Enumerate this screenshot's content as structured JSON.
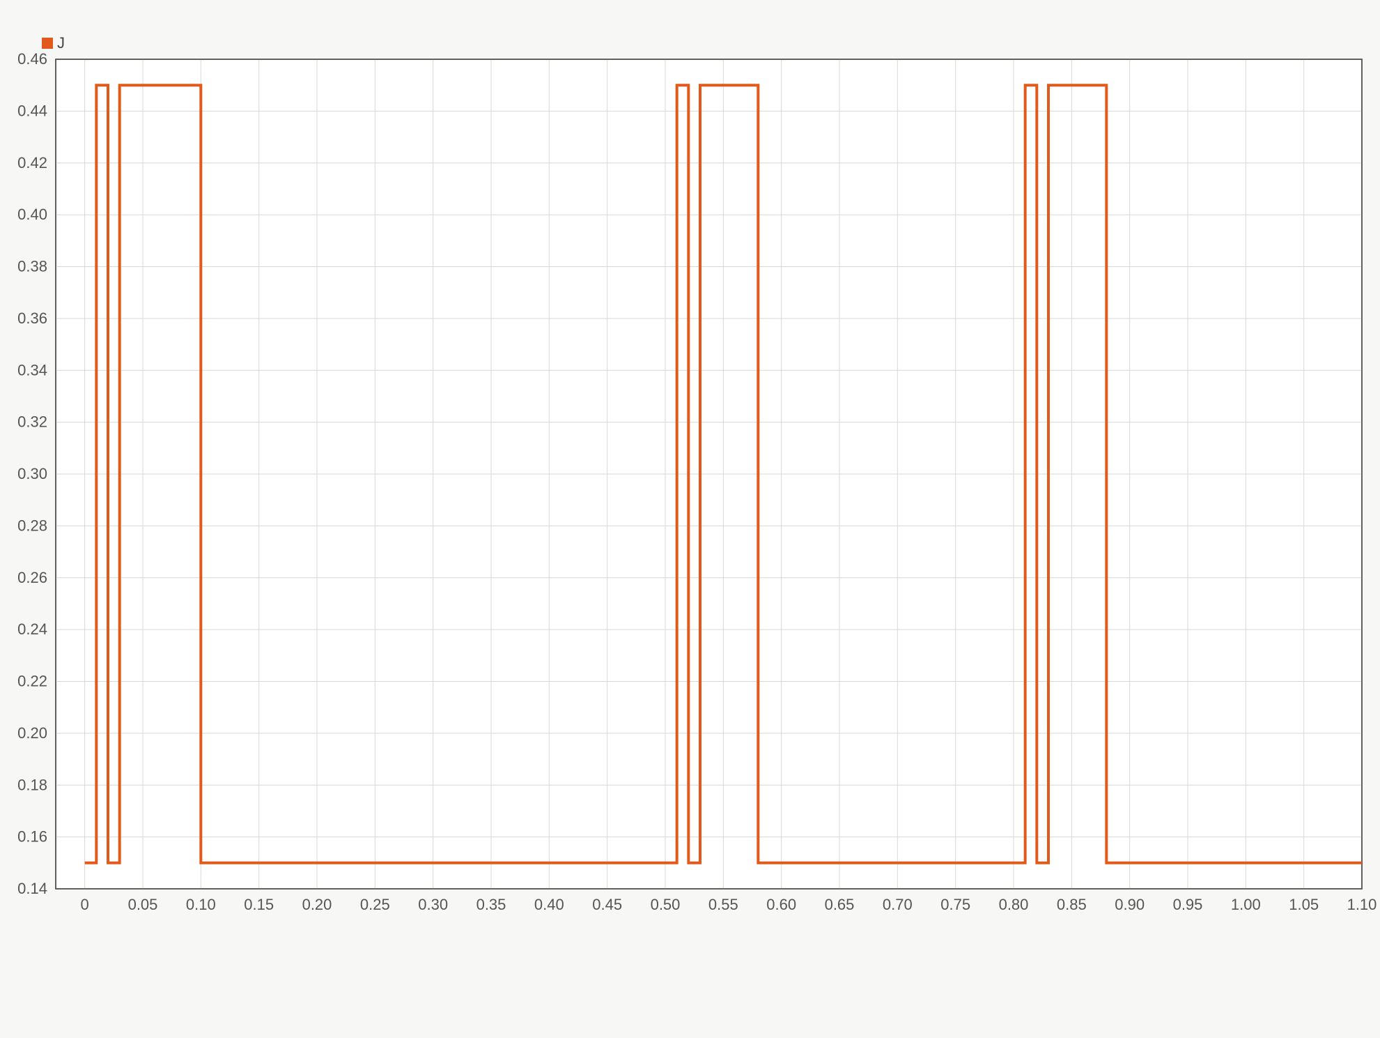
{
  "chart_data": {
    "type": "line",
    "title": "",
    "xlabel": "",
    "ylabel": "",
    "xlim": [
      -0.025,
      1.1
    ],
    "ylim": [
      0.14,
      0.46
    ],
    "x_ticks": [
      0,
      0.05,
      0.1,
      0.15,
      0.2,
      0.25,
      0.3,
      0.35,
      0.4,
      0.45,
      0.5,
      0.55,
      0.6,
      0.65,
      0.7,
      0.75,
      0.8,
      0.85,
      0.9,
      0.95,
      1.0,
      1.05,
      1.1
    ],
    "x_tick_labels": [
      "0",
      "0.05",
      "0.10",
      "0.15",
      "0.20",
      "0.25",
      "0.30",
      "0.35",
      "0.40",
      "0.45",
      "0.50",
      "0.55",
      "0.60",
      "0.65",
      "0.70",
      "0.75",
      "0.80",
      "0.85",
      "0.90",
      "0.95",
      "1.00",
      "1.05",
      "1.10"
    ],
    "y_ticks": [
      0.14,
      0.16,
      0.18,
      0.2,
      0.22,
      0.24,
      0.26,
      0.28,
      0.3,
      0.32,
      0.34,
      0.36,
      0.38,
      0.4,
      0.42,
      0.44,
      0.46
    ],
    "y_tick_labels": [
      "0.14",
      "0.16",
      "0.18",
      "0.20",
      "0.22",
      "0.24",
      "0.26",
      "0.28",
      "0.30",
      "0.32",
      "0.34",
      "0.36",
      "0.38",
      "0.40",
      "0.42",
      "0.44",
      "0.46"
    ],
    "series": [
      {
        "name": "J",
        "color": "#e25a1b",
        "step_points": [
          [
            0.0,
            0.15
          ],
          [
            0.01,
            0.15
          ],
          [
            0.01,
            0.45
          ],
          [
            0.02,
            0.45
          ],
          [
            0.02,
            0.15
          ],
          [
            0.03,
            0.15
          ],
          [
            0.03,
            0.45
          ],
          [
            0.1,
            0.45
          ],
          [
            0.1,
            0.15
          ],
          [
            0.51,
            0.15
          ],
          [
            0.51,
            0.45
          ],
          [
            0.52,
            0.45
          ],
          [
            0.52,
            0.15
          ],
          [
            0.53,
            0.15
          ],
          [
            0.53,
            0.45
          ],
          [
            0.58,
            0.45
          ],
          [
            0.58,
            0.15
          ],
          [
            0.81,
            0.15
          ],
          [
            0.81,
            0.45
          ],
          [
            0.82,
            0.45
          ],
          [
            0.82,
            0.15
          ],
          [
            0.83,
            0.15
          ],
          [
            0.83,
            0.45
          ],
          [
            0.88,
            0.45
          ],
          [
            0.88,
            0.15
          ],
          [
            1.1,
            0.15
          ]
        ]
      }
    ],
    "legend": {
      "position": "top-left",
      "items": [
        "J"
      ]
    },
    "grid": true
  },
  "legend_label": "J"
}
